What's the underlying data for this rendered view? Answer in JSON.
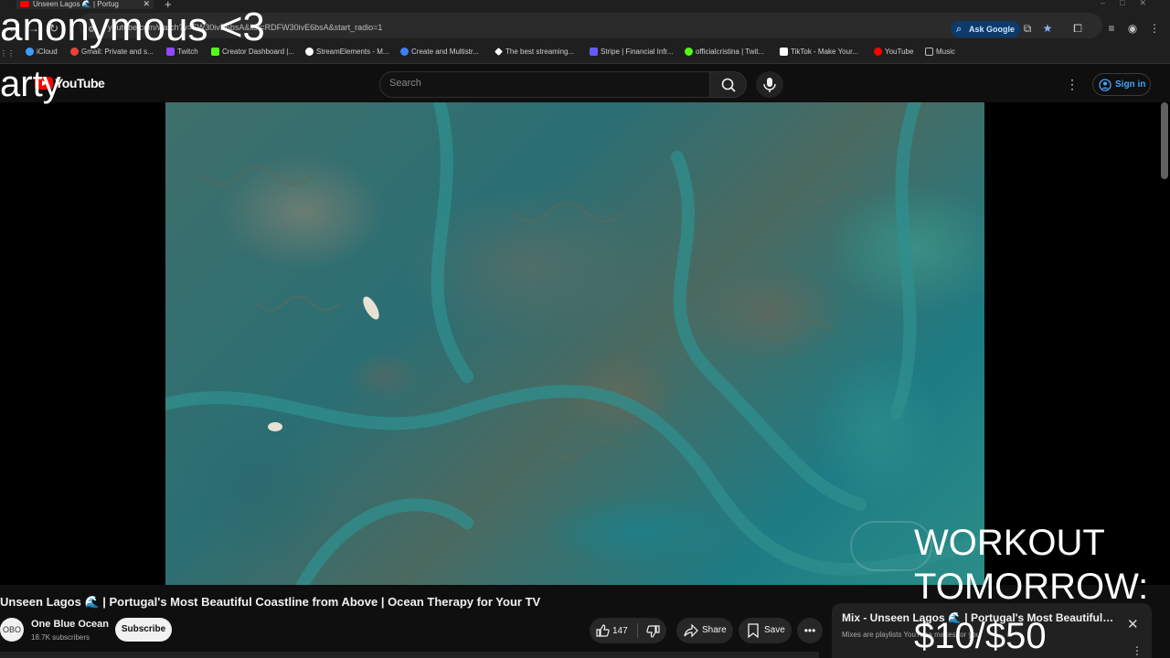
{
  "browser": {
    "tab_title": "Unseen Lagos 🌊 | Portug",
    "url": "youtube.com/watch?v=FW30ivE6bsA&list=RDFW30ivE6bsA&start_radio=1",
    "ask_google": "Ask Google",
    "bookmarks": [
      {
        "label": "iCloud",
        "color": "#3aa0ff"
      },
      {
        "label": "Gmail: Private and s...",
        "color": "#ea4335"
      },
      {
        "label": "Twitch",
        "color": "#9146ff"
      },
      {
        "label": "Creator Dashboard |...",
        "color": "#53fc18"
      },
      {
        "label": "StreamElements - M...",
        "color": "#ffffff"
      },
      {
        "label": "Create and Multistr...",
        "color": "#3b82f6"
      },
      {
        "label": "The best streaming...",
        "color": "#ffffff"
      },
      {
        "label": "Stripe | Financial Infr...",
        "color": "#635bff"
      },
      {
        "label": "officialcristina | Twit...",
        "color": "#53fc18"
      },
      {
        "label": "TikTok - Make Your...",
        "color": "#ffffff"
      },
      {
        "label": "YouTube",
        "color": "#ff0000"
      },
      {
        "label": "Music",
        "color": "#bbbbbb"
      }
    ]
  },
  "masthead": {
    "logo_text": "YouTube",
    "search_placeholder": "Search",
    "sign_in": "Sign in"
  },
  "overlays": {
    "top_line1": "anonymous <3",
    "top_line2": "arty",
    "bottom_line1": "WORKOUT",
    "bottom_line2": "TOMORROW:",
    "bottom_line3": "$10/$50"
  },
  "video": {
    "title": "Unseen Lagos 🌊 | Portugal's Most Beautiful Coastline from Above | Ocean Therapy for Your TV",
    "channel_name": "One Blue Ocean",
    "channel_avatar_text": "OBO",
    "subscribers": "18.7K subscribers",
    "subscribe_label": "Subscribe",
    "like_count": "147",
    "share_label": "Share",
    "save_label": "Save"
  },
  "mix": {
    "title": "Mix - Unseen Lagos 🌊 | Portugal's Most Beautiful Coastline from Above",
    "subtitle": "Mixes are playlists YouTube makes for you"
  },
  "colors": {
    "accent": "#ff0000",
    "link": "#3ea6ff",
    "background": "#0f0f0f"
  }
}
